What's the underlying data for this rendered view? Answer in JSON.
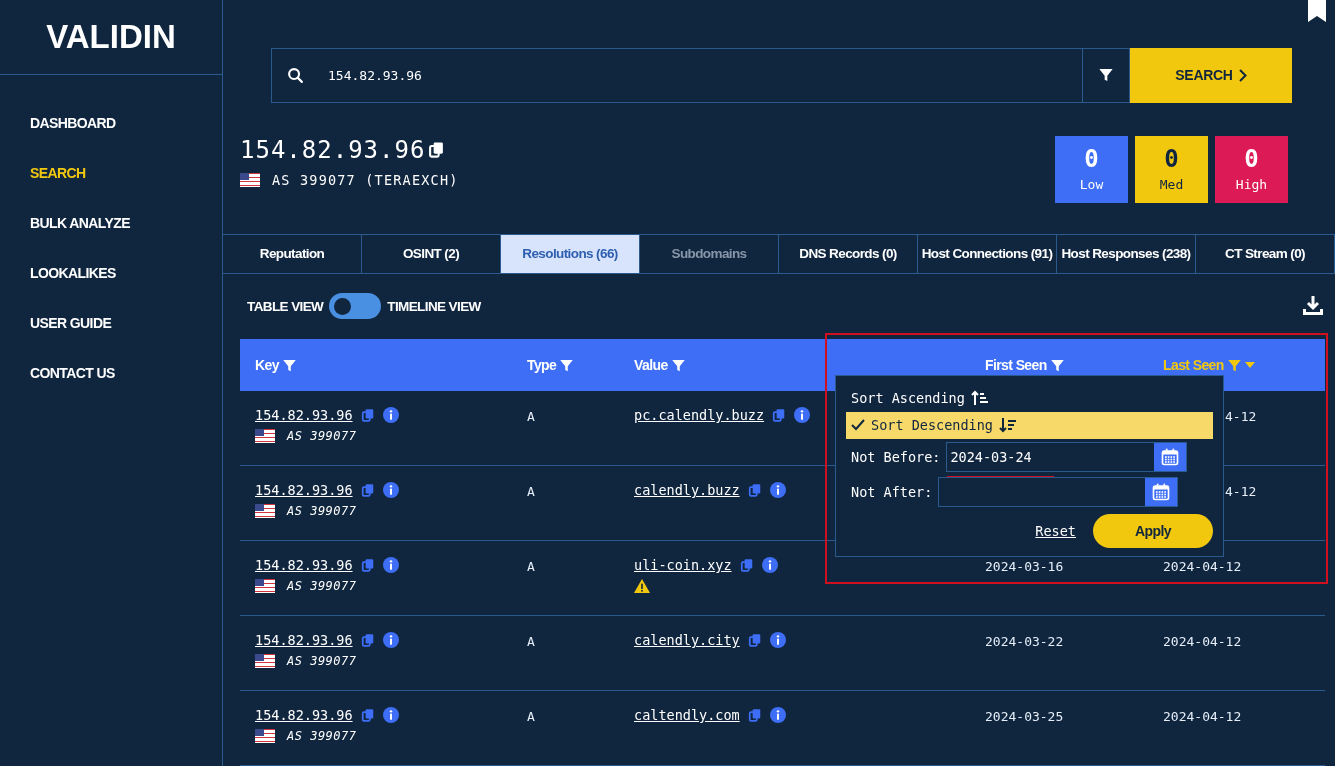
{
  "sidebar": {
    "logo": "VALIDIN",
    "items": [
      {
        "label": "DASHBOARD",
        "selected": false
      },
      {
        "label": "SEARCH",
        "selected": true
      },
      {
        "label": "BULK ANALYZE",
        "selected": false
      },
      {
        "label": "LOOKALIKES",
        "selected": false
      },
      {
        "label": "USER GUIDE",
        "selected": false
      },
      {
        "label": "CONTACT US",
        "selected": false
      }
    ]
  },
  "search": {
    "value": "154.82.93.96",
    "button": "SEARCH"
  },
  "indicator": {
    "title": "154.82.93.96",
    "asn": "AS 399077 (TERAEXCH)"
  },
  "risk": [
    {
      "count": "0",
      "label": "Low",
      "color": "#3d6ef5"
    },
    {
      "count": "0",
      "label": "Med",
      "color": "#f2c80f"
    },
    {
      "count": "0",
      "label": "High",
      "color": "#dc1a56"
    }
  ],
  "tabs": [
    {
      "label": "Reputation",
      "selected": false,
      "disabled": false
    },
    {
      "label": "OSINT (2)",
      "selected": false,
      "disabled": false
    },
    {
      "label": "Resolutions (66)",
      "selected": true,
      "disabled": false
    },
    {
      "label": "Subdomains",
      "selected": false,
      "disabled": true
    },
    {
      "label": "DNS Records (0)",
      "selected": false,
      "disabled": false
    },
    {
      "label": "Host Connections (91)",
      "selected": false,
      "disabled": false
    },
    {
      "label": "Host Responses (238)",
      "selected": false,
      "disabled": false
    },
    {
      "label": "CT Stream (0)",
      "selected": false,
      "disabled": false
    }
  ],
  "view_toggle": {
    "left": "TABLE VIEW",
    "right": "TIMELINE VIEW",
    "on": false
  },
  "table": {
    "columns": [
      {
        "label": "Key",
        "active": false
      },
      {
        "label": "Type",
        "active": false
      },
      {
        "label": "Value",
        "active": false
      },
      {
        "label": "First Seen",
        "active": false
      },
      {
        "label": "Last Seen",
        "active": true
      }
    ],
    "rows": [
      {
        "key": "154.82.93.96",
        "asn": "AS 399077",
        "type": "A",
        "value": "pc.calendly.buzz",
        "warning": false,
        "last_seen": "4-12"
      },
      {
        "key": "154.82.93.96",
        "asn": "AS 399077",
        "type": "A",
        "value": "calendly.buzz",
        "warning": false,
        "last_seen": "4-12"
      },
      {
        "key": "154.82.93.96",
        "asn": "AS 399077",
        "type": "A",
        "value": "uli-coin.xyz",
        "warning": true,
        "first_seen": "2024-03-16",
        "last_seen": "2024-04-12"
      },
      {
        "key": "154.82.93.96",
        "asn": "AS 399077",
        "type": "A",
        "value": "calendly.city",
        "warning": false,
        "first_seen": "2024-03-22",
        "last_seen": "2024-04-12"
      },
      {
        "key": "154.82.93.96",
        "asn": "AS 399077",
        "type": "A",
        "value": "caltendly.com",
        "warning": false,
        "first_seen": "2024-03-25",
        "last_seen": "2024-04-12"
      }
    ]
  },
  "sort_menu": {
    "options": [
      {
        "label": "Sort Ascending",
        "selected": false,
        "kind": "ascending"
      },
      {
        "label": "Sort Descending",
        "selected": true,
        "kind": "descending"
      }
    ],
    "not_before": {
      "label": "Not Before:",
      "value": "2024-03-24"
    },
    "not_after": {
      "label": "Not After:"
    },
    "reset": "Reset",
    "apply": "Apply"
  }
}
